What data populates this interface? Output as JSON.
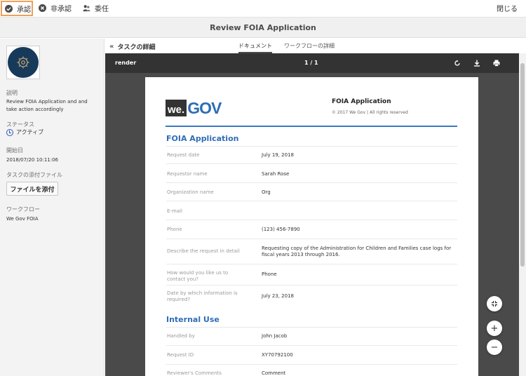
{
  "toolbar": {
    "approve_label": "承認",
    "reject_label": "非承認",
    "delegate_label": "委任",
    "close_label": "閉じる"
  },
  "title": "Review FOIA Application",
  "sidebar": {
    "description_label": "説明",
    "description_value": "Review FOIA Application and and take action accordingly",
    "status_label": "ステータス",
    "status_value": "アクティブ",
    "start_label": "開始日",
    "start_value": "2018/07/20 10:11:06",
    "attachments_label": "タスクの添付ファイル",
    "attach_button": "ファイルを添付",
    "workflow_label": "ワークフロー",
    "workflow_value": "We Gov FOIA"
  },
  "main": {
    "back_label": "タスクの詳細",
    "tabs": [
      {
        "label": "ドキュメント",
        "active": true
      },
      {
        "label": "ワークフローの詳細",
        "active": false
      }
    ]
  },
  "viewer": {
    "filename": "render",
    "page_indicator": "1 / 1",
    "icons": [
      "refresh-icon",
      "download-icon",
      "print-icon"
    ]
  },
  "document": {
    "logo_we": "we.",
    "logo_gov": "GOV",
    "header_title": "FOIA Application",
    "copyright": "© 2017 We Gov | All rights reserved",
    "section1": "FOIA Application",
    "fields": [
      {
        "label": "Request date",
        "value": "July 19, 2018"
      },
      {
        "label": "Requestor name",
        "value": "Sarah Rose"
      },
      {
        "label": "Organization name",
        "value": "Org"
      },
      {
        "label": "E-mail",
        "value": ""
      },
      {
        "label": "Phone",
        "value": "(123) 456-7890"
      },
      {
        "label": "Describe the request in detail",
        "value": "Requesting copy of the Administration for Children and Families case logs for fiscal years 2013 through 2016."
      },
      {
        "label": "How would you like us to contact you?",
        "value": "Phone"
      },
      {
        "label": "Date by which information is required?",
        "value": "July 23, 2018"
      }
    ],
    "section2": "Internal Use",
    "internal_fields": [
      {
        "label": "Handled by",
        "value": "John Jacob"
      },
      {
        "label": "Request ID",
        "value": "XY70792100"
      },
      {
        "label": "Reviewer's Comments",
        "value": "Comment"
      }
    ]
  },
  "zoom": {
    "plus": "+",
    "minus": "−"
  },
  "colors": {
    "accent": "#2f6db5",
    "highlight": "#f1a05a",
    "avatar": "#183a5a"
  }
}
